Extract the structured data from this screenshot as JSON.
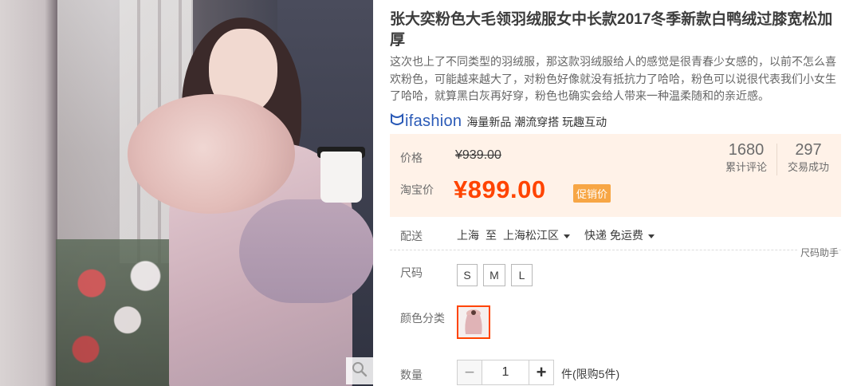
{
  "product": {
    "title": "张大奕粉色大毛领羽绒服女中长款2017冬季新款白鸭绒过膝宽松加厚",
    "description": "这次也上了不同类型的羽绒服，那这款羽绒服给人的感觉是很青春少女感的，以前不怎么喜欢粉色，可能越来越大了，对粉色好像就没有抵抗力了哈哈，粉色可以说很代表我们小女生了哈哈，就算黑白灰再好穿，粉色也确实会给人带来一种温柔随和的亲近感。",
    "brand_logo_text": "ifashion",
    "brand_slogan": "海量新品 潮流穿搭 玩趣互动"
  },
  "price": {
    "label": "价格",
    "original": "¥939.00",
    "taobao_label": "淘宝价",
    "current": "¥899.00",
    "promo_tag": "促销价"
  },
  "stats": {
    "reviews_count": "1680",
    "reviews_label": "累计评论",
    "deals_count": "297",
    "deals_label": "交易成功"
  },
  "shipping": {
    "label": "配送",
    "from": "上海",
    "to_word": "至",
    "to": "上海松江区",
    "method": "快递",
    "fee": "免运费"
  },
  "size": {
    "label": "尺码",
    "helper": "尺码助手",
    "options": [
      "S",
      "M",
      "L"
    ]
  },
  "color": {
    "label": "颜色分类"
  },
  "quantity": {
    "label": "数量",
    "value": "1",
    "minus": "−",
    "plus": "+",
    "note": "件(限购5件)"
  },
  "colors": {
    "accent": "#ff4400",
    "price_bg": "#fff2e8",
    "promo_bg": "#f7a645",
    "brand_blue": "#2a5ab7"
  },
  "icons": {
    "zoom": "magnifier-icon",
    "brand": "ifashion-logo-icon",
    "dropdown": "chevron-down-icon"
  }
}
